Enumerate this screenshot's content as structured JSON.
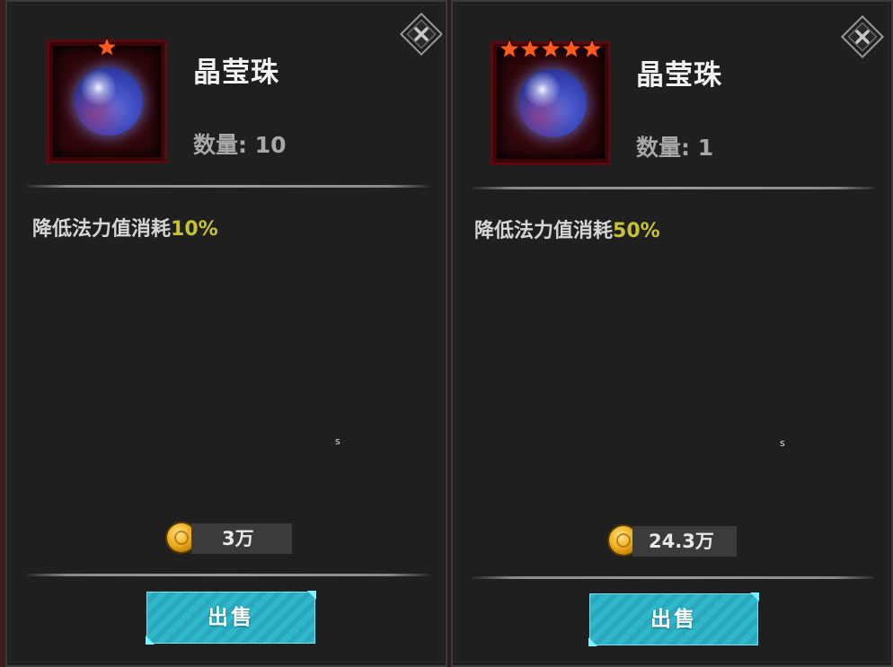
{
  "panels": [
    {
      "item_name": "晶莹珠",
      "quantity_text": "数量: 10",
      "star_count": 1,
      "effect_prefix": "降低法力值消耗",
      "effect_value": "10%",
      "stray_text": "s",
      "price": "3万",
      "sell_label": "出售"
    },
    {
      "item_name": "晶莹珠",
      "quantity_text": "数量: 1",
      "star_count": 5,
      "effect_prefix": "降低法力值消耗",
      "effect_value": "50%",
      "stray_text": "s",
      "price": "24.3万",
      "sell_label": "出售"
    }
  ],
  "icons": {
    "close": "close-icon",
    "star": "star-icon",
    "item": "crystal-orb-icon",
    "currency": "gold-coin-icon"
  },
  "colors": {
    "panel_bg": "#1f1f1f",
    "effect_highlight": "#c6c232",
    "star": "#ff5a1f",
    "sell_button": "#2fb8cc",
    "item_frame": "#5a0a0e"
  }
}
